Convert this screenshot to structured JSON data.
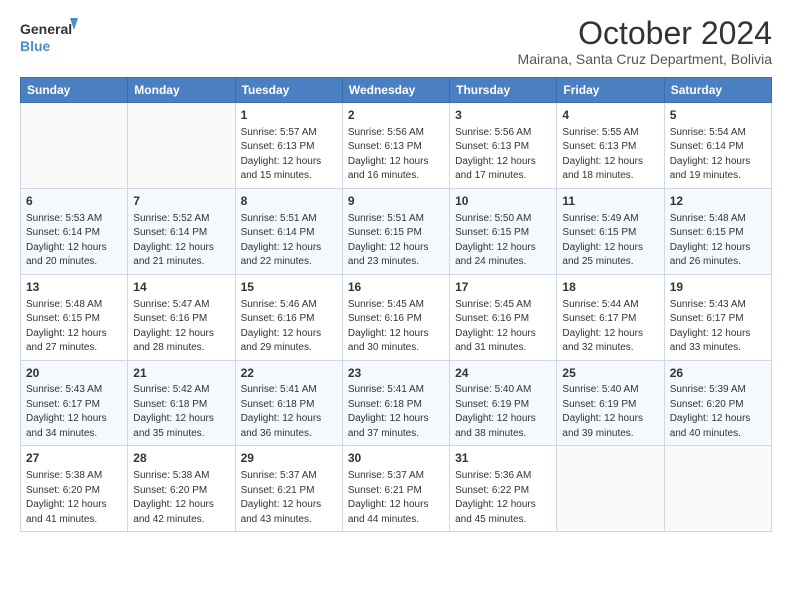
{
  "logo": {
    "line1": "General",
    "line2": "Blue"
  },
  "title": "October 2024",
  "subtitle": "Mairana, Santa Cruz Department, Bolivia",
  "days_header": [
    "Sunday",
    "Monday",
    "Tuesday",
    "Wednesday",
    "Thursday",
    "Friday",
    "Saturday"
  ],
  "weeks": [
    [
      {
        "num": "",
        "info": ""
      },
      {
        "num": "",
        "info": ""
      },
      {
        "num": "1",
        "info": "Sunrise: 5:57 AM\nSunset: 6:13 PM\nDaylight: 12 hours and 15 minutes."
      },
      {
        "num": "2",
        "info": "Sunrise: 5:56 AM\nSunset: 6:13 PM\nDaylight: 12 hours and 16 minutes."
      },
      {
        "num": "3",
        "info": "Sunrise: 5:56 AM\nSunset: 6:13 PM\nDaylight: 12 hours and 17 minutes."
      },
      {
        "num": "4",
        "info": "Sunrise: 5:55 AM\nSunset: 6:13 PM\nDaylight: 12 hours and 18 minutes."
      },
      {
        "num": "5",
        "info": "Sunrise: 5:54 AM\nSunset: 6:14 PM\nDaylight: 12 hours and 19 minutes."
      }
    ],
    [
      {
        "num": "6",
        "info": "Sunrise: 5:53 AM\nSunset: 6:14 PM\nDaylight: 12 hours and 20 minutes."
      },
      {
        "num": "7",
        "info": "Sunrise: 5:52 AM\nSunset: 6:14 PM\nDaylight: 12 hours and 21 minutes."
      },
      {
        "num": "8",
        "info": "Sunrise: 5:51 AM\nSunset: 6:14 PM\nDaylight: 12 hours and 22 minutes."
      },
      {
        "num": "9",
        "info": "Sunrise: 5:51 AM\nSunset: 6:15 PM\nDaylight: 12 hours and 23 minutes."
      },
      {
        "num": "10",
        "info": "Sunrise: 5:50 AM\nSunset: 6:15 PM\nDaylight: 12 hours and 24 minutes."
      },
      {
        "num": "11",
        "info": "Sunrise: 5:49 AM\nSunset: 6:15 PM\nDaylight: 12 hours and 25 minutes."
      },
      {
        "num": "12",
        "info": "Sunrise: 5:48 AM\nSunset: 6:15 PM\nDaylight: 12 hours and 26 minutes."
      }
    ],
    [
      {
        "num": "13",
        "info": "Sunrise: 5:48 AM\nSunset: 6:15 PM\nDaylight: 12 hours and 27 minutes."
      },
      {
        "num": "14",
        "info": "Sunrise: 5:47 AM\nSunset: 6:16 PM\nDaylight: 12 hours and 28 minutes."
      },
      {
        "num": "15",
        "info": "Sunrise: 5:46 AM\nSunset: 6:16 PM\nDaylight: 12 hours and 29 minutes."
      },
      {
        "num": "16",
        "info": "Sunrise: 5:45 AM\nSunset: 6:16 PM\nDaylight: 12 hours and 30 minutes."
      },
      {
        "num": "17",
        "info": "Sunrise: 5:45 AM\nSunset: 6:16 PM\nDaylight: 12 hours and 31 minutes."
      },
      {
        "num": "18",
        "info": "Sunrise: 5:44 AM\nSunset: 6:17 PM\nDaylight: 12 hours and 32 minutes."
      },
      {
        "num": "19",
        "info": "Sunrise: 5:43 AM\nSunset: 6:17 PM\nDaylight: 12 hours and 33 minutes."
      }
    ],
    [
      {
        "num": "20",
        "info": "Sunrise: 5:43 AM\nSunset: 6:17 PM\nDaylight: 12 hours and 34 minutes."
      },
      {
        "num": "21",
        "info": "Sunrise: 5:42 AM\nSunset: 6:18 PM\nDaylight: 12 hours and 35 minutes."
      },
      {
        "num": "22",
        "info": "Sunrise: 5:41 AM\nSunset: 6:18 PM\nDaylight: 12 hours and 36 minutes."
      },
      {
        "num": "23",
        "info": "Sunrise: 5:41 AM\nSunset: 6:18 PM\nDaylight: 12 hours and 37 minutes."
      },
      {
        "num": "24",
        "info": "Sunrise: 5:40 AM\nSunset: 6:19 PM\nDaylight: 12 hours and 38 minutes."
      },
      {
        "num": "25",
        "info": "Sunrise: 5:40 AM\nSunset: 6:19 PM\nDaylight: 12 hours and 39 minutes."
      },
      {
        "num": "26",
        "info": "Sunrise: 5:39 AM\nSunset: 6:20 PM\nDaylight: 12 hours and 40 minutes."
      }
    ],
    [
      {
        "num": "27",
        "info": "Sunrise: 5:38 AM\nSunset: 6:20 PM\nDaylight: 12 hours and 41 minutes."
      },
      {
        "num": "28",
        "info": "Sunrise: 5:38 AM\nSunset: 6:20 PM\nDaylight: 12 hours and 42 minutes."
      },
      {
        "num": "29",
        "info": "Sunrise: 5:37 AM\nSunset: 6:21 PM\nDaylight: 12 hours and 43 minutes."
      },
      {
        "num": "30",
        "info": "Sunrise: 5:37 AM\nSunset: 6:21 PM\nDaylight: 12 hours and 44 minutes."
      },
      {
        "num": "31",
        "info": "Sunrise: 5:36 AM\nSunset: 6:22 PM\nDaylight: 12 hours and 45 minutes."
      },
      {
        "num": "",
        "info": ""
      },
      {
        "num": "",
        "info": ""
      }
    ]
  ]
}
